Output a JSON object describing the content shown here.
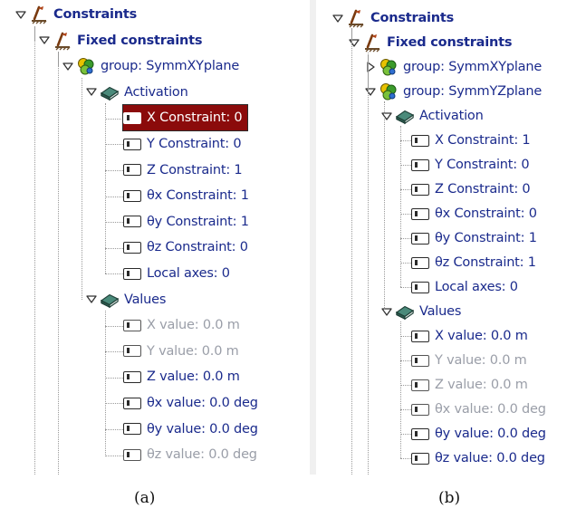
{
  "panel_a": {
    "caption": "(a)",
    "rows": [
      {
        "label": "Constraints",
        "bold": true,
        "icon": "constraint-icon"
      },
      {
        "label": "Fixed constraints",
        "bold": true,
        "icon": "constraint-icon"
      },
      {
        "label": "group: SymmXYplane",
        "icon": "group-icon",
        "expander": "expanded"
      },
      {
        "label": "Activation",
        "icon": "folder-book-icon",
        "expander": "expanded"
      },
      {
        "label": "X Constraint: 0",
        "icon": "checkbox-icon",
        "selected": true
      },
      {
        "label": "Y Constraint: 0",
        "icon": "checkbox-icon"
      },
      {
        "label": "Z Constraint: 1",
        "icon": "checkbox-icon"
      },
      {
        "label": "θx Constraint: 1",
        "icon": "checkbox-icon"
      },
      {
        "label": "θy Constraint: 1",
        "icon": "checkbox-icon"
      },
      {
        "label": "θz Constraint: 0",
        "icon": "checkbox-icon"
      },
      {
        "label": "Local axes: 0",
        "icon": "checkbox-icon"
      },
      {
        "label": "Values",
        "icon": "folder-book-icon",
        "expander": "expanded"
      },
      {
        "label": "X value: 0.0 m",
        "icon": "checkbox-icon",
        "grey": true
      },
      {
        "label": "Y value: 0.0 m",
        "icon": "checkbox-icon",
        "grey": true
      },
      {
        "label": "Z value: 0.0 m",
        "icon": "checkbox-icon"
      },
      {
        "label": "θx value: 0.0 deg",
        "icon": "checkbox-icon"
      },
      {
        "label": "θy value: 0.0 deg",
        "icon": "checkbox-icon"
      },
      {
        "label": "θz value: 0.0 deg",
        "icon": "checkbox-icon",
        "grey": true
      }
    ]
  },
  "panel_b": {
    "caption": "(b)",
    "rows": [
      {
        "label": "Constraints",
        "bold": true,
        "icon": "constraint-icon"
      },
      {
        "label": "Fixed constraints",
        "bold": true,
        "icon": "constraint-icon"
      },
      {
        "label": "group: SymmXYplane",
        "icon": "group-icon",
        "expander": "collapsed"
      },
      {
        "label": "group: SymmYZplane",
        "icon": "group-icon",
        "expander": "expanded"
      },
      {
        "label": "Activation",
        "icon": "folder-book-icon",
        "expander": "expanded"
      },
      {
        "label": "X Constraint: 1",
        "icon": "checkbox-icon"
      },
      {
        "label": "Y Constraint: 0",
        "icon": "checkbox-icon"
      },
      {
        "label": "Z Constraint: 0",
        "icon": "checkbox-icon"
      },
      {
        "label": "θx Constraint: 0",
        "icon": "checkbox-icon"
      },
      {
        "label": "θy Constraint: 1",
        "icon": "checkbox-icon"
      },
      {
        "label": "θz Constraint: 1",
        "icon": "checkbox-icon"
      },
      {
        "label": "Local axes: 0",
        "icon": "checkbox-icon"
      },
      {
        "label": "Values",
        "icon": "folder-book-icon",
        "expander": "expanded"
      },
      {
        "label": "X value: 0.0 m",
        "icon": "checkbox-icon"
      },
      {
        "label": "Y value: 0.0 m",
        "icon": "checkbox-icon",
        "grey": true
      },
      {
        "label": "Z value: 0.0 m",
        "icon": "checkbox-icon",
        "grey": true
      },
      {
        "label": "θx value: 0.0 deg",
        "icon": "checkbox-icon",
        "grey": true
      },
      {
        "label": "θy value: 0.0 deg",
        "icon": "checkbox-icon"
      },
      {
        "label": "θz value: 0.0 deg",
        "icon": "checkbox-icon"
      }
    ]
  },
  "colors": {
    "text": "#1a2a8c",
    "disabled_text": "#9a9ea8",
    "selection": "#8b0b0b"
  }
}
